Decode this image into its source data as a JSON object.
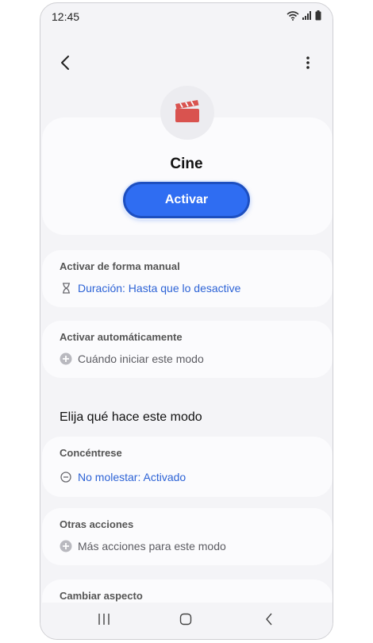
{
  "status_bar": {
    "time": "12:45"
  },
  "mode": {
    "name": "Cine",
    "activate_label": "Activar"
  },
  "manual_card": {
    "title": "Activar de forma manual",
    "duration": "Duración: Hasta que lo desactive"
  },
  "auto_card": {
    "title": "Activar automáticamente",
    "when_start": "Cuándo iniciar este modo"
  },
  "section_heading": "Elija qué hace este modo",
  "focus_card": {
    "title": "Concéntrese",
    "dnd": "No molestar: Activado"
  },
  "other_card": {
    "title": "Otras acciones",
    "more_actions": "Más acciones para este modo"
  },
  "appearance_card": {
    "title": "Cambiar aspecto"
  },
  "colors": {
    "accent": "#2f6df2",
    "link": "#2d63d6",
    "clapperboard": "#d9534f"
  },
  "icons": {
    "back": "chevron-left-icon",
    "more": "more-vertical-icon",
    "mode": "clapperboard-icon",
    "hourglass": "hourglass-icon",
    "add": "plus-circle-icon",
    "dnd": "minus-circle-icon"
  }
}
